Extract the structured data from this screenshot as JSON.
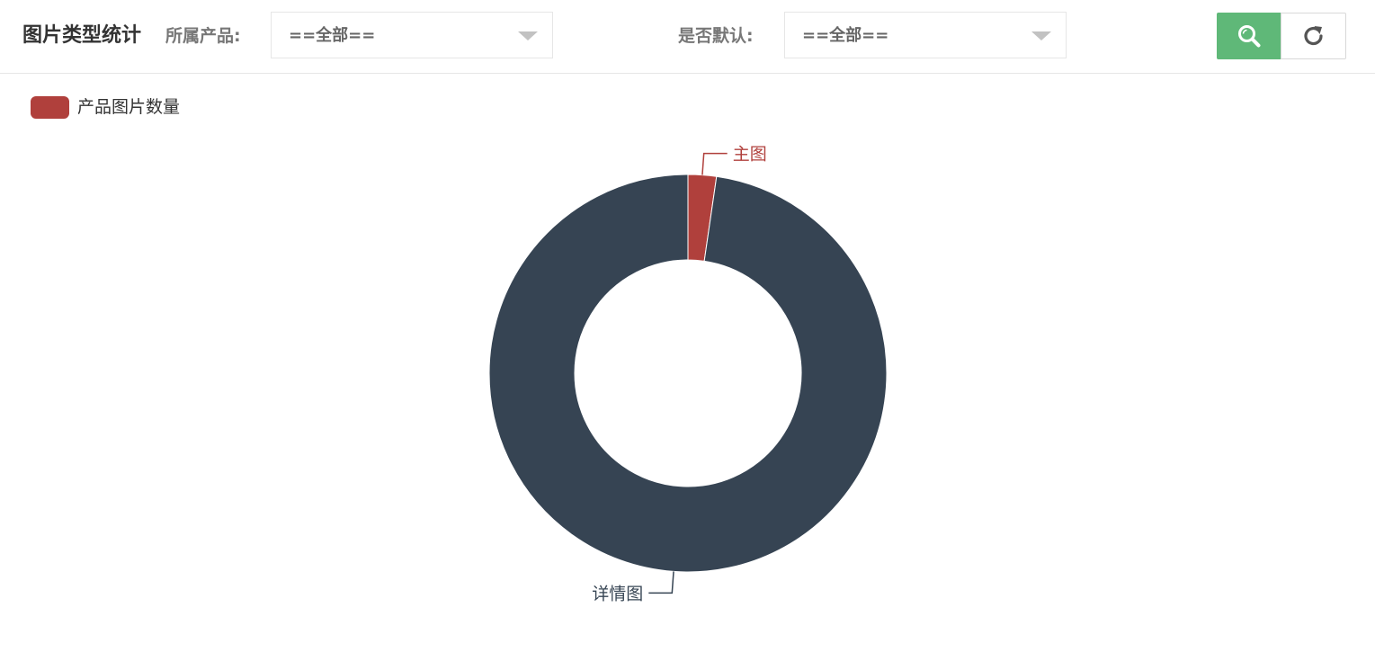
{
  "page": {
    "title": "图片类型统计"
  },
  "filters": {
    "product_label": "所属产品:",
    "product_value": "==全部==",
    "default_label": "是否默认:",
    "default_value": "==全部=="
  },
  "icons": {
    "search": "search-icon",
    "refresh": "refresh-icon",
    "dropdown": "chevron-down-icon"
  },
  "colors": {
    "search_button": "#5fb878",
    "series_main": "#b0403c",
    "series_detail": "#364453"
  },
  "chart_data": {
    "type": "pie",
    "variant": "donut",
    "legend": {
      "entries": [
        "产品图片数量"
      ],
      "placement": "top-left"
    },
    "series": [
      {
        "name": "产品图片数量",
        "slices": [
          {
            "label": "主图",
            "value": 2.3,
            "color": "#b0403c"
          },
          {
            "label": "详情图",
            "value": 97.7,
            "color": "#364453"
          }
        ]
      }
    ]
  }
}
